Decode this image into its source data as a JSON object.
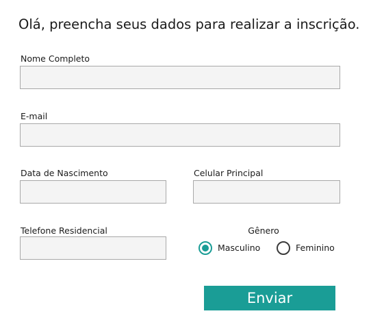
{
  "heading": "Olá, preencha seus dados para realizar a inscrição.",
  "form": {
    "full_name": {
      "label": "Nome Completo",
      "value": ""
    },
    "email": {
      "label": "E-mail",
      "value": ""
    },
    "birth_date": {
      "label": "Data de Nascimento",
      "value": ""
    },
    "mobile_phone": {
      "label": "Celular Principal",
      "value": ""
    },
    "home_phone": {
      "label": "Telefone Residencial",
      "value": ""
    },
    "gender": {
      "label": "Gênero",
      "options": [
        "Masculino",
        "Feminino"
      ],
      "selected": "Masculino"
    },
    "submit_label": "Enviar"
  },
  "colors": {
    "accent": "#1a9d96",
    "input_background": "#f4f4f4",
    "input_border": "#a8a8a8",
    "text": "#1a1a1a"
  },
  "icons": {
    "radio_checked": "radio-checked-icon",
    "radio_unchecked": "radio-unchecked-icon"
  }
}
